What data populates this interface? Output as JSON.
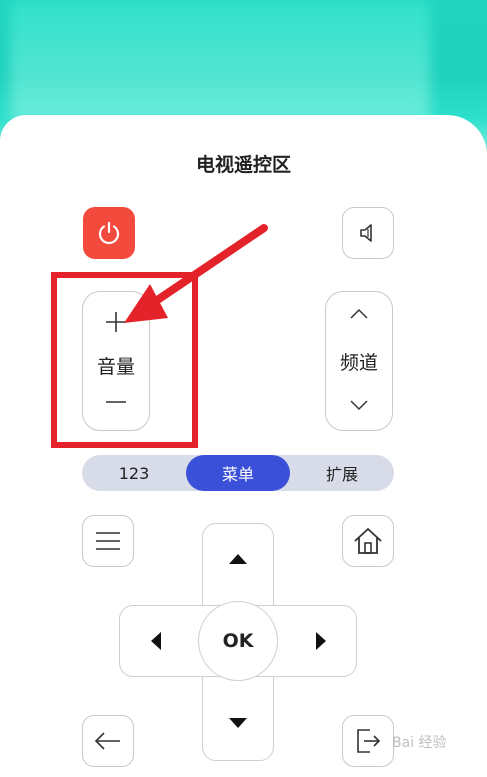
{
  "header": {
    "title": "电视遥控区"
  },
  "buttons": {
    "power_icon": "power-icon",
    "mute_icon": "mute-icon",
    "volume": {
      "plus": "+",
      "label": "音量",
      "minus": "—"
    },
    "channel": {
      "label": "频道"
    },
    "ok_label": "OK"
  },
  "segmented": {
    "items": [
      {
        "label": "123",
        "active": false
      },
      {
        "label": "菜单",
        "active": true
      },
      {
        "label": "扩展",
        "active": false
      }
    ]
  },
  "watermark": {
    "text": "Bai 经验"
  },
  "colors": {
    "teal": "#1fd2be",
    "power": "#f24a3c",
    "active_segment": "#3a50d8",
    "annotation": "#e4222a"
  }
}
